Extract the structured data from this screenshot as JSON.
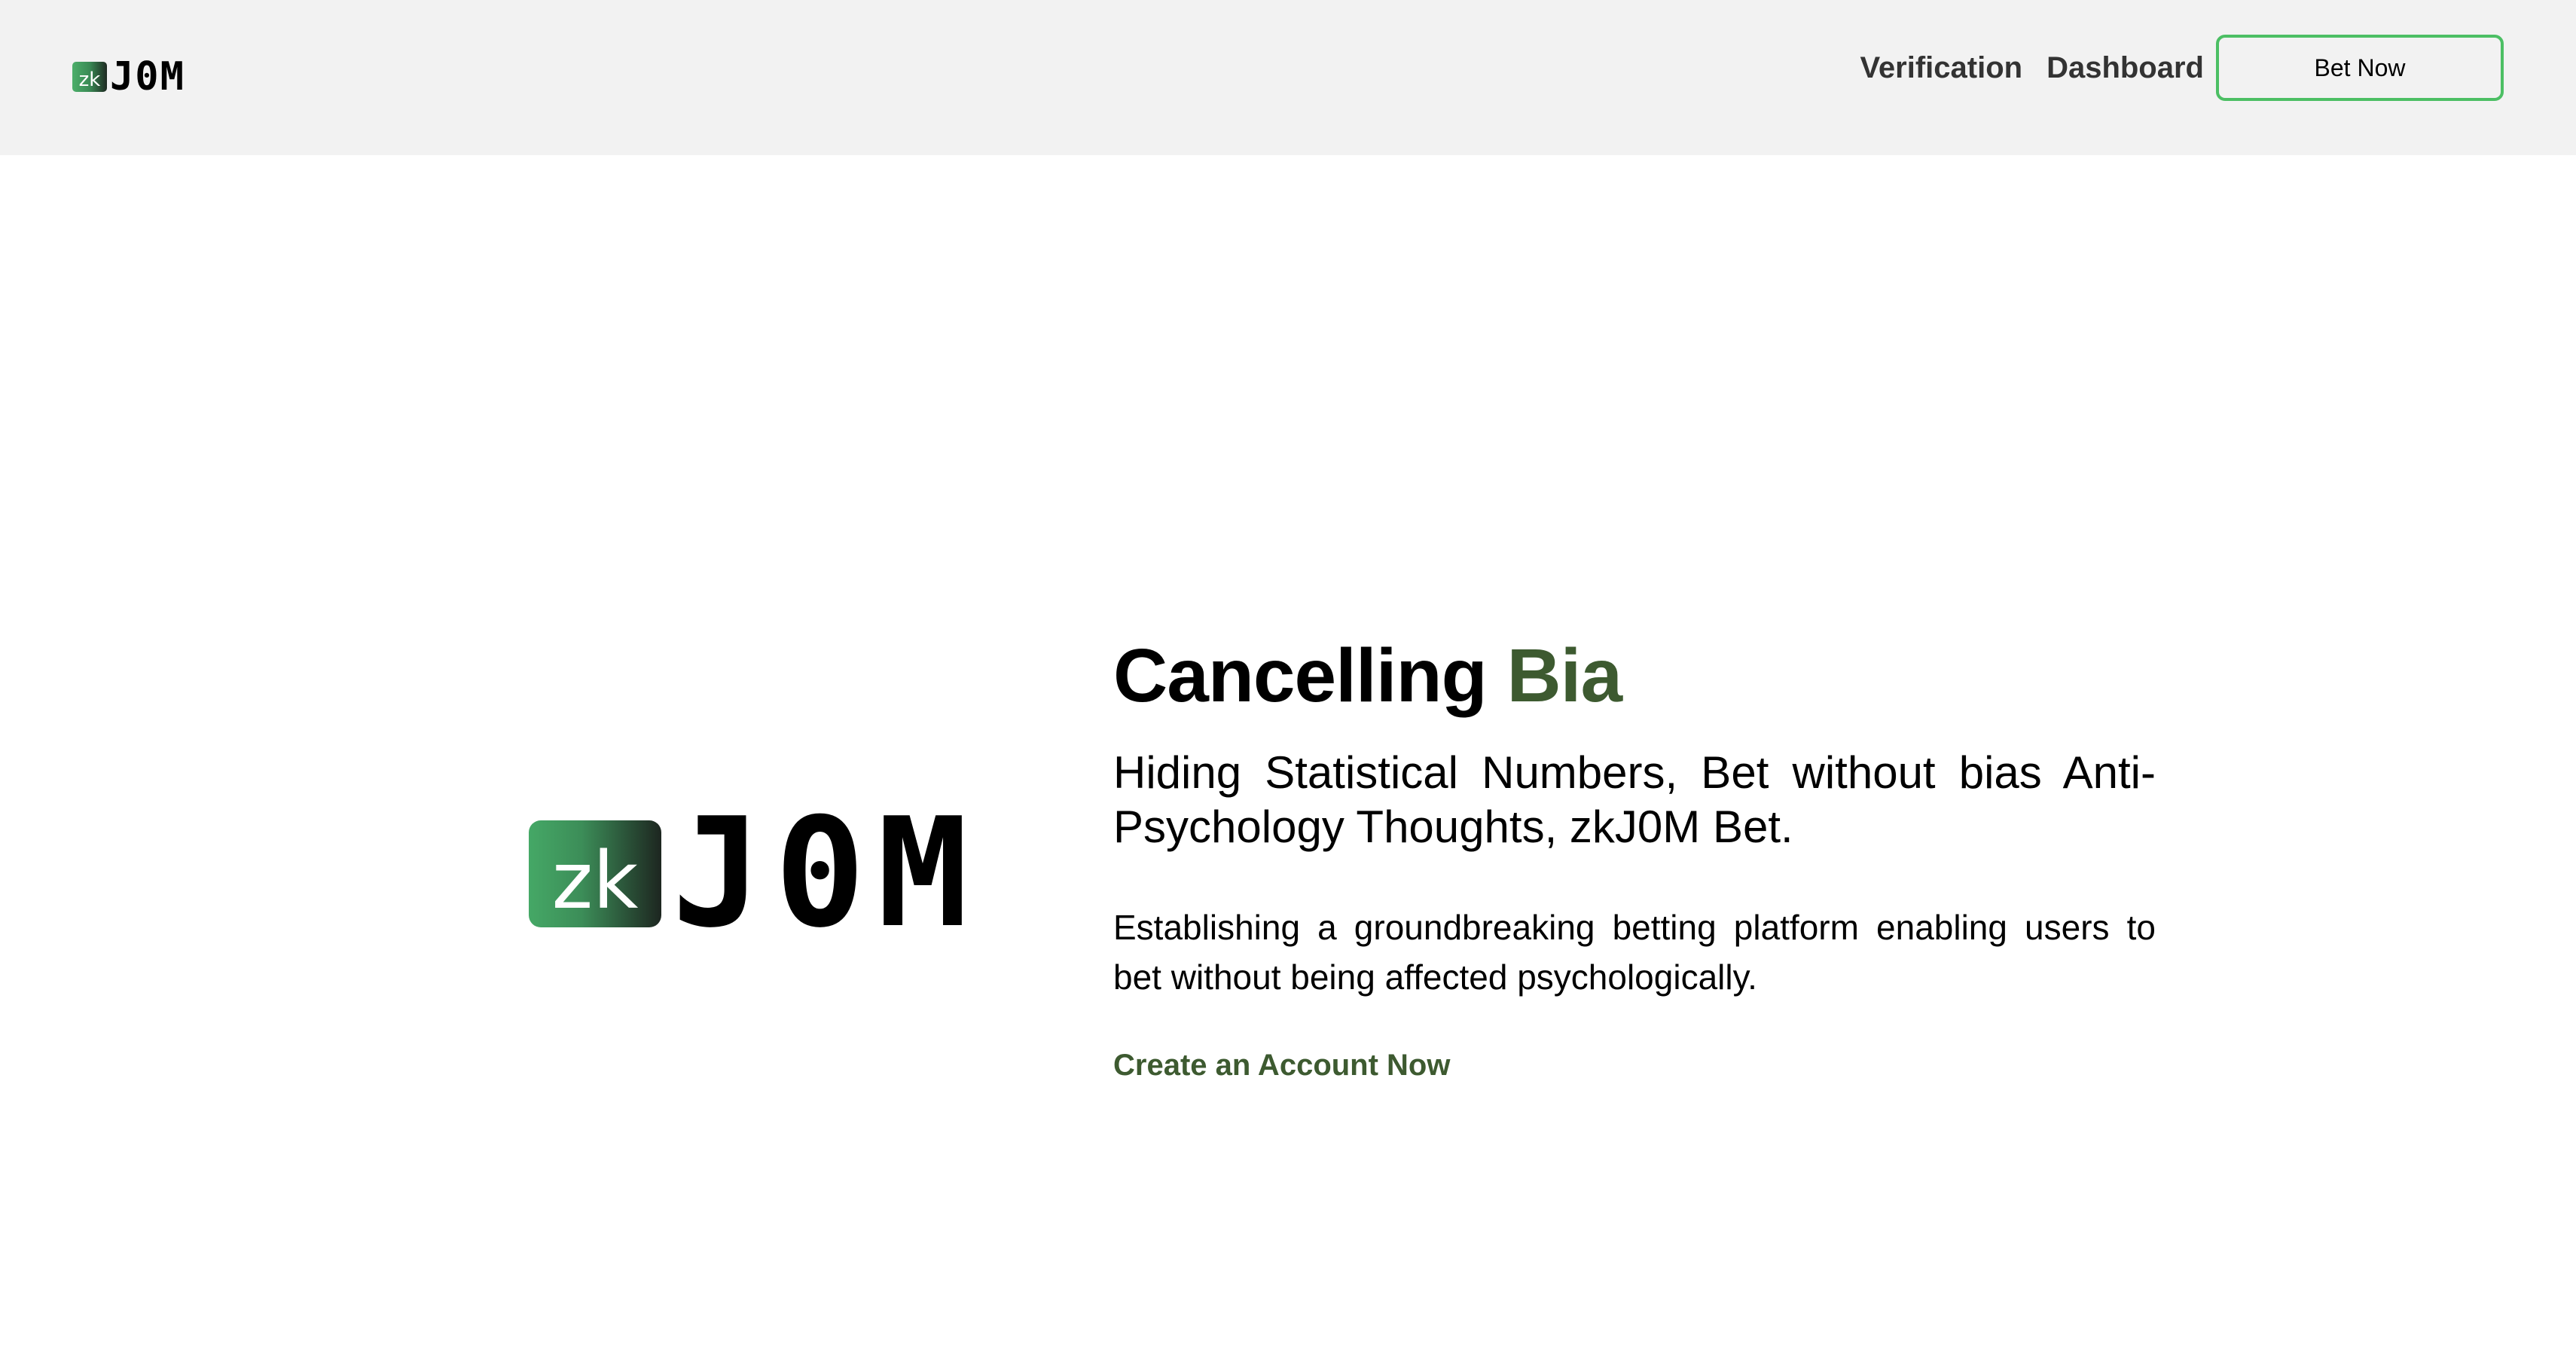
{
  "header": {
    "logo": {
      "badge": "zk",
      "wordmark": "J0M"
    },
    "nav": [
      {
        "label": "Verification"
      },
      {
        "label": "Dashboard"
      }
    ],
    "cta_label": "Bet Now"
  },
  "hero": {
    "logo": {
      "badge": "zk",
      "wordmark": "J0M"
    },
    "headline_main": "Cancelling",
    "headline_accent": "Bia",
    "subtitle": "Hiding Statistical Numbers, Bet without bias Anti-Psychology Thoughts, zkJ0M Bet.",
    "description": "Establishing a groundbreaking betting platform enabling users to bet without being affected psychologically.",
    "cta_link": "Create an Account Now"
  },
  "colors": {
    "accent": "#3d5a30",
    "button_border": "#4cbf64",
    "header_bg": "#f2f2f2"
  }
}
